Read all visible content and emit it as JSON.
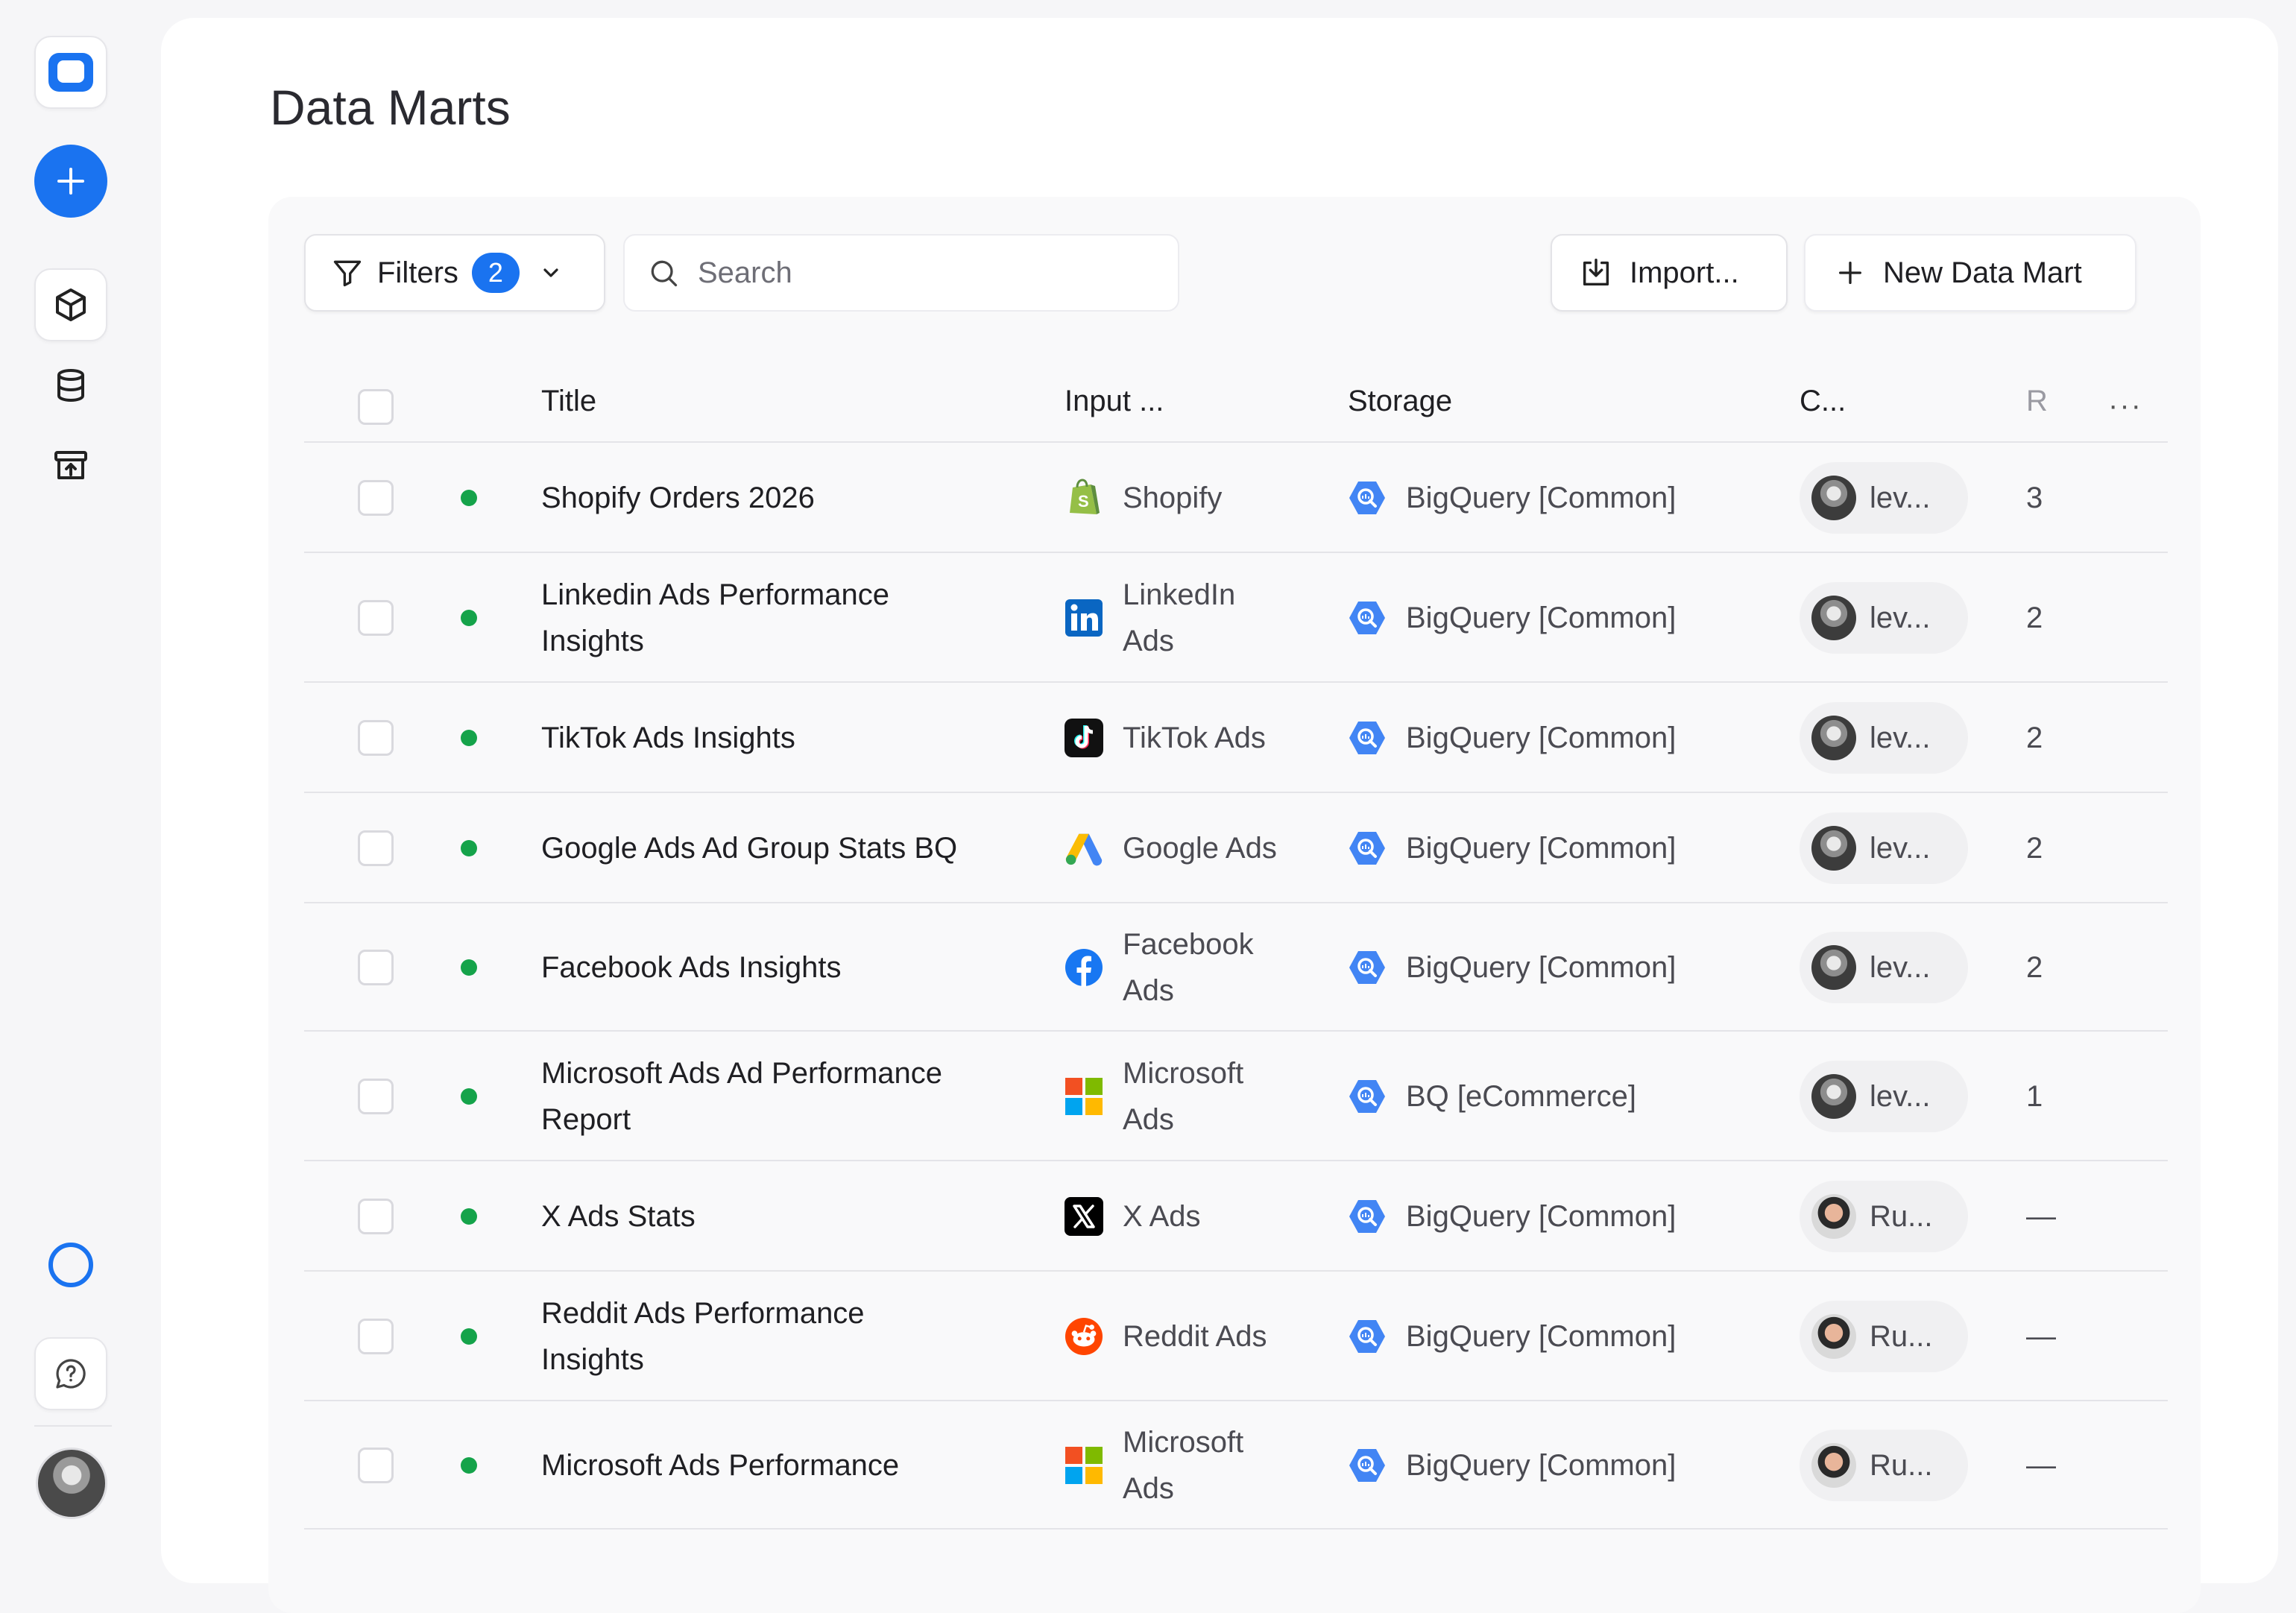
{
  "page": {
    "title": "Data Marts"
  },
  "toolbar": {
    "filters_label": "Filters",
    "filters_count": "2",
    "search_placeholder": "Search",
    "import_label": "Import...",
    "new_label": "New Data Mart"
  },
  "table": {
    "headers": {
      "title": "Title",
      "input": "Input ...",
      "storage": "Storage",
      "creator": "C...",
      "reports": "R",
      "more": "···"
    },
    "rows": [
      {
        "title_lines": [
          "Shopify Orders 2026"
        ],
        "input_lines": [
          "Shopify"
        ],
        "input_icon": "shopify-icon",
        "storage": "BigQuery [Common]",
        "owner": "lev...",
        "owner_avatar": "lev",
        "count": "3"
      },
      {
        "title_lines": [
          "Linkedin Ads Performance",
          "Insights"
        ],
        "input_lines": [
          "LinkedIn",
          "Ads"
        ],
        "input_icon": "linkedin-icon",
        "storage": "BigQuery [Common]",
        "owner": "lev...",
        "owner_avatar": "lev",
        "count": "2"
      },
      {
        "title_lines": [
          "TikTok Ads Insights"
        ],
        "input_lines": [
          "TikTok Ads"
        ],
        "input_icon": "tiktok-icon",
        "storage": "BigQuery [Common]",
        "owner": "lev...",
        "owner_avatar": "lev",
        "count": "2"
      },
      {
        "title_lines": [
          "Google Ads Ad Group Stats BQ"
        ],
        "input_lines": [
          "Google Ads"
        ],
        "input_icon": "google-ads-icon",
        "storage": "BigQuery [Common]",
        "owner": "lev...",
        "owner_avatar": "lev",
        "count": "2"
      },
      {
        "title_lines": [
          "Facebook Ads Insights"
        ],
        "input_lines": [
          "Facebook",
          "Ads"
        ],
        "input_icon": "facebook-icon",
        "storage": "BigQuery [Common]",
        "owner": "lev...",
        "owner_avatar": "lev",
        "count": "2"
      },
      {
        "title_lines": [
          "Microsoft Ads Ad Performance",
          "Report"
        ],
        "input_lines": [
          "Microsoft",
          "Ads"
        ],
        "input_icon": "microsoft-icon",
        "storage": "BQ [eCommerce]",
        "owner": "lev...",
        "owner_avatar": "lev",
        "count": "1"
      },
      {
        "title_lines": [
          "X Ads Stats"
        ],
        "input_lines": [
          "X Ads"
        ],
        "input_icon": "x-icon",
        "storage": "BigQuery [Common]",
        "owner": "Ru...",
        "owner_avatar": "ru",
        "count": "—"
      },
      {
        "title_lines": [
          "Reddit Ads Performance",
          "Insights"
        ],
        "input_lines": [
          "Reddit Ads"
        ],
        "input_icon": "reddit-icon",
        "storage": "BigQuery [Common]",
        "owner": "Ru...",
        "owner_avatar": "ru",
        "count": "—"
      },
      {
        "title_lines": [
          "Microsoft Ads Performance"
        ],
        "input_lines": [
          "Microsoft",
          "Ads"
        ],
        "input_icon": "microsoft-icon",
        "storage": "BigQuery [Common]",
        "owner": "Ru...",
        "owner_avatar": "ru",
        "count": "—"
      }
    ]
  },
  "colors": {
    "accent": "#1a73f0",
    "status_active": "#15a34a",
    "bigquery": "#4285f4"
  }
}
